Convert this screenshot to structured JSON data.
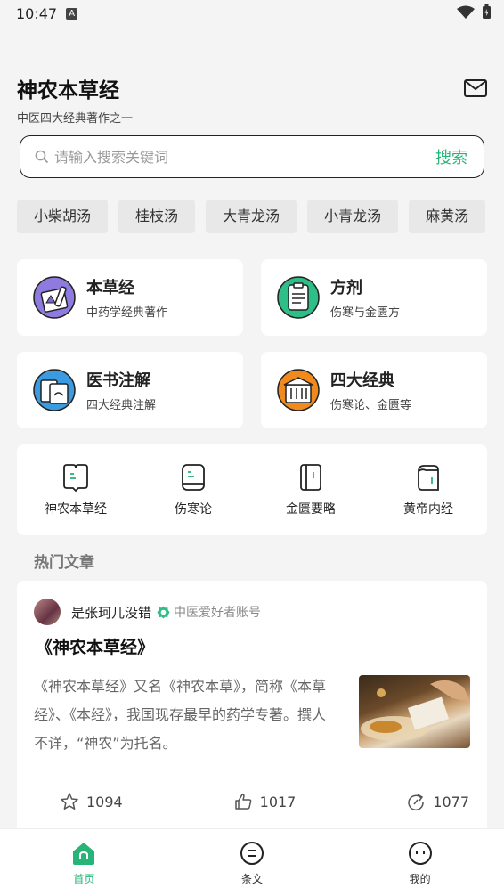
{
  "status": {
    "time": "10:47",
    "badge": "A"
  },
  "header": {
    "title": "神农本草经",
    "subtitle": "中医四大经典著作之一"
  },
  "search": {
    "placeholder": "请输入搜索关键词",
    "button": "搜索"
  },
  "tags": [
    "小柴胡汤",
    "桂枝汤",
    "大青龙汤",
    "小青龙汤",
    "麻黄汤"
  ],
  "cards": [
    {
      "title": "本草经",
      "desc": "中药学经典著作",
      "icon": "herb-book-icon",
      "color": "#7b68c9"
    },
    {
      "title": "方剂",
      "desc": "伤寒与金匮方",
      "icon": "clipboard-icon",
      "color": "#2dbf87"
    },
    {
      "title": "医书注解",
      "desc": "四大经典注解",
      "icon": "annotated-book-icon",
      "color": "#3a9be0"
    },
    {
      "title": "四大经典",
      "desc": "伤寒论、金匮等",
      "icon": "classics-icon",
      "color": "#f08a1c"
    }
  ],
  "books": [
    {
      "label": "神农本草经"
    },
    {
      "label": "伤寒论"
    },
    {
      "label": "金匮要略"
    },
    {
      "label": "黄帝内经"
    }
  ],
  "section_title": "热门文章",
  "article": {
    "author": "是张珂儿没错",
    "author_tag": "中医爱好者账号",
    "title": "《神农本草经》",
    "summary": "《神农本草经》又名《神农本草》，简称《本草经》、《本经》，我国现存最早的药学专著。撰人不详，“神农”为托名。",
    "stars": "1094",
    "likes": "1017",
    "shares": "1077"
  },
  "nav": [
    {
      "label": "首页",
      "active": true
    },
    {
      "label": "条文",
      "active": false
    },
    {
      "label": "我的",
      "active": false
    }
  ],
  "colors": {
    "accent": "#26b479"
  }
}
